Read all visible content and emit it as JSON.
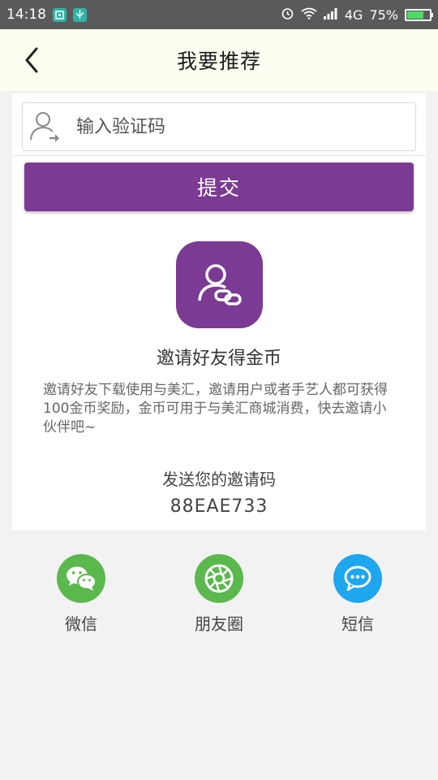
{
  "status_bar": {
    "time": "14:18",
    "network": "4G",
    "battery": "75%",
    "battery_level": 0.75
  },
  "header": {
    "title": "我要推荐",
    "back_icon": "chevron-left-icon"
  },
  "code_input": {
    "placeholder": "输入验证码",
    "value": "",
    "icon": "user-transfer-icon"
  },
  "submit": {
    "label": "提交"
  },
  "invite": {
    "badge_icon": "user-link-icon",
    "title": "邀请好友得金币",
    "description": "邀请好友下载使用与美汇，邀请用户或者手艺人都可获得100金币奖励，金币可用于与美汇商城消费，快去邀请小伙伴吧~",
    "send_label": "发送您的邀请码",
    "code": "88EAE733"
  },
  "share": {
    "items": [
      {
        "label": "微信",
        "icon": "wechat-icon",
        "color": "#5bb84d"
      },
      {
        "label": "朋友圈",
        "icon": "moments-icon",
        "color": "#5bb84d"
      },
      {
        "label": "短信",
        "icon": "sms-icon",
        "color": "#1ea6ef"
      }
    ]
  },
  "colors": {
    "primary": "#7b3a93",
    "header_bg": "#fdfdf2",
    "page_bg": "#f2f2f2"
  }
}
